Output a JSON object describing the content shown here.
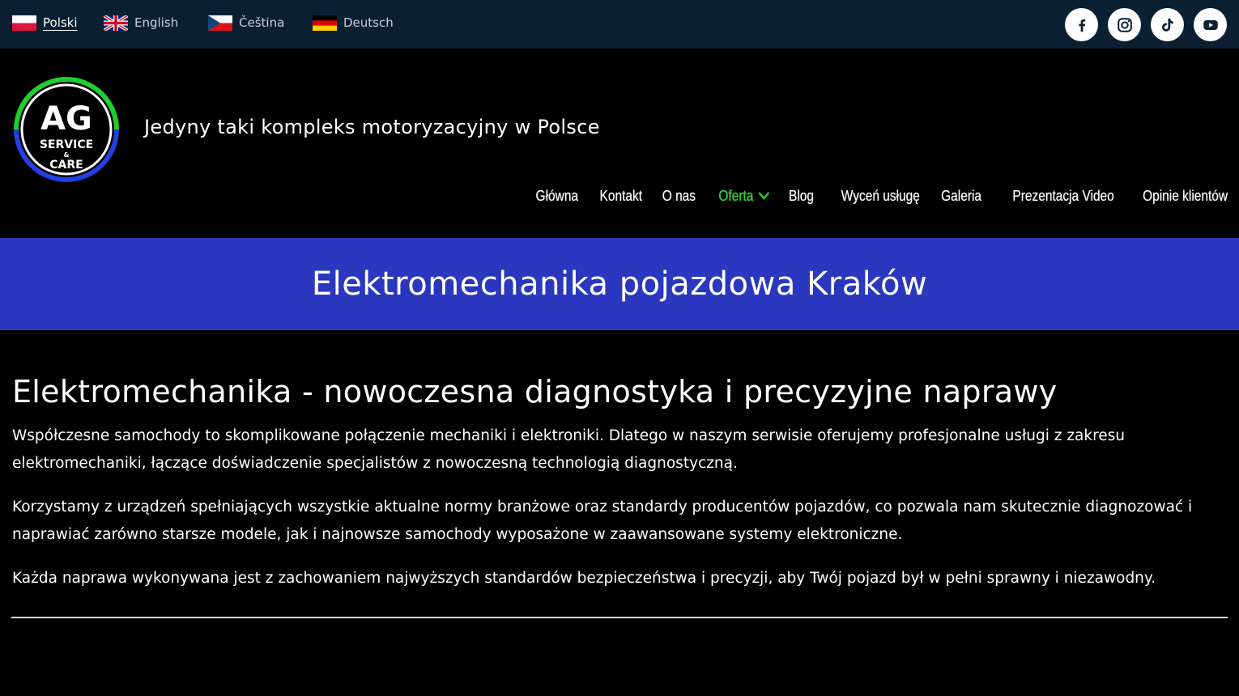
{
  "languages": [
    {
      "label": "Polski",
      "flag": "pl-flag-icon",
      "active": true
    },
    {
      "label": "English",
      "flag": "uk-flag-icon",
      "active": false
    },
    {
      "label": "Čeština",
      "flag": "cz-flag-icon",
      "active": false
    },
    {
      "label": "Deutsch",
      "flag": "de-flag-icon",
      "active": false
    }
  ],
  "social": [
    "facebook-icon",
    "instagram-icon",
    "tiktok-icon",
    "youtube-icon"
  ],
  "logo": {
    "line1": "AG",
    "line2": "SERVICE",
    "line3": "&",
    "line4": "CARE"
  },
  "header": {
    "tagline": "Jedyny taki kompleks motoryzacyjny w Polsce"
  },
  "nav": {
    "items": [
      {
        "label": "Główna"
      },
      {
        "label": "Kontakt"
      },
      {
        "label": "O nas"
      },
      {
        "label": "Oferta",
        "active": true
      },
      {
        "label": "Blog"
      },
      {
        "label": "Wyceń usługę"
      },
      {
        "label": "Galeria"
      },
      {
        "label": "Prezentacja Video"
      },
      {
        "label": "Opinie klientów"
      }
    ]
  },
  "banner": {
    "title": "Elektromechanika pojazdowa Kraków"
  },
  "content": {
    "heading": "Elektromechanika - nowoczesna diagnostyka i precyzyjne naprawy",
    "paragraphs": [
      "Współczesne samochody to skomplikowane połączenie mechaniki i elektroniki. Dlatego w naszym serwisie oferujemy profesjonalne usługi z zakresu elektromechaniki, łączące doświadczenie specjalistów z nowoczesną technologią diagnostyczną.",
      "Korzystamy z urządzeń spełniających wszystkie aktualne normy branżowe oraz standardy producentów pojazdów, co pozwala nam skutecznie diagnozować i naprawiać zarówno starsze modele, jak i najnowsze samochody wyposażone w zaawansowane systemy elektroniczne.",
      "Każda naprawa wykonywana jest z zachowaniem najwyższych standardów bezpieczeństwa i precyzji, aby Twój pojazd był w pełni sprawny i niezawodny."
    ]
  },
  "colors": {
    "topbar": "#0b1f33",
    "banner": "#2b37be",
    "accent": "#22d62a",
    "background": "#000000"
  }
}
